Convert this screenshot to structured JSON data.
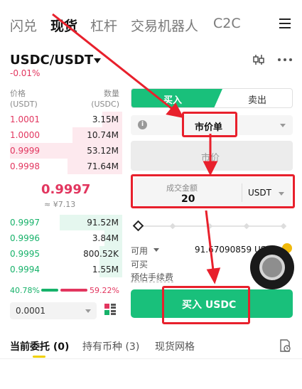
{
  "colors": {
    "buy_green": "#19c07b",
    "sell_red": "#e2365f",
    "annotation_red": "#e8202c"
  },
  "nav": {
    "tabs": [
      {
        "label": "闪兑",
        "active": false
      },
      {
        "label": "现货",
        "active": true
      },
      {
        "label": "杠杆",
        "active": false
      },
      {
        "label": "交易机器人",
        "active": false
      },
      {
        "label": "C2C",
        "active": false
      }
    ],
    "menu_icon": "hamburger-icon"
  },
  "market": {
    "pair": "USDC/USDT",
    "change": "-0.01%",
    "chart_icon": "candlestick-icon",
    "more_icon": "more-dots-icon"
  },
  "orderbook": {
    "price_header": [
      "价格",
      "(USDT)"
    ],
    "qty_header": [
      "数量",
      "(USDC)"
    ],
    "asks": [
      {
        "price": "1.0001",
        "qty": "3.15M",
        "depth": 0.18
      },
      {
        "price": "1.0000",
        "qty": "10.74M",
        "depth": 0.44
      },
      {
        "price": "0.9999",
        "qty": "53.12M",
        "depth": 1.0
      },
      {
        "price": "0.9998",
        "qty": "71.64M",
        "depth": 0.49
      }
    ],
    "mid_price": "0.9997",
    "mid_fiat": "≈ ¥7.13",
    "bids": [
      {
        "price": "0.9997",
        "qty": "91.52M",
        "depth": 0.56
      },
      {
        "price": "0.9996",
        "qty": "3.84M",
        "depth": 0.16
      },
      {
        "price": "0.9995",
        "qty": "800.52K",
        "depth": 0.2
      },
      {
        "price": "0.9994",
        "qty": "1.55M",
        "depth": 0.2
      }
    ],
    "buy_ratio": "40.78%",
    "sell_ratio": "59.22%",
    "depth_value": "0.0001",
    "depth_icon": "grid-icon"
  },
  "order_form": {
    "buy_tab": "买入",
    "sell_tab": "卖出",
    "order_type": "市价单",
    "price_placeholder": "市价",
    "amount_label": "成交金额",
    "amount_value": "20",
    "amount_unit": "USDT",
    "available_label": "可用",
    "available_value": "91.67090859 US",
    "can_buy_label": "可买",
    "fee_label": "预估手续费",
    "submit_label": "买入 USDC"
  },
  "bottom_tabs": [
    {
      "label": "当前委托 (0)",
      "active": true
    },
    {
      "label": "持有币种 (3)",
      "active": false
    },
    {
      "label": "现货网格",
      "active": false
    }
  ],
  "bottom_icon": "history-icon"
}
